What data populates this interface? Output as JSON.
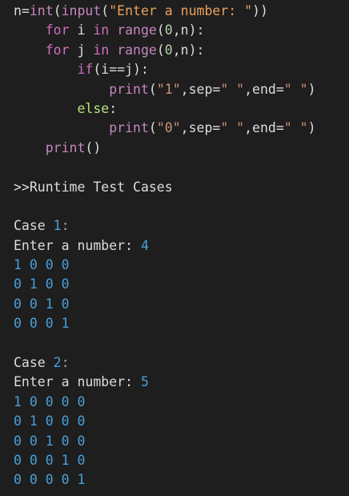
{
  "code": {
    "l1": {
      "a": "n=",
      "b": "int",
      "c": "(",
      "d": "input",
      "e": "(",
      "f": "\"Enter a number: \"",
      "g": "))"
    },
    "l2": {
      "indent": "    ",
      "kw": "for",
      "v": " i ",
      "kw2": "in",
      "sp": " ",
      "fn": "range",
      "p1": "(",
      "n0": "0",
      "rest": ",n):"
    },
    "l3": {
      "indent": "    ",
      "kw": "for",
      "v": " j ",
      "kw2": "in",
      "sp": " ",
      "fn": "range",
      "p1": "(",
      "n0": "0",
      "rest": ",n):"
    },
    "l4": {
      "indent": "        ",
      "kw": "if",
      "rest": "(i==j):"
    },
    "l5": {
      "indent": "            ",
      "fn": "print",
      "p1": "(",
      "s1": "\"1\"",
      "m1": ",sep=",
      "s2": "\" \"",
      "m2": ",end=",
      "s3": "\" \"",
      "p2": ")"
    },
    "l6": {
      "indent": "        ",
      "kw": "else",
      "rest": ":"
    },
    "l7": {
      "indent": "            ",
      "fn": "print",
      "p1": "(",
      "s1": "\"0\"",
      "m1": ",sep=",
      "s2": "\" \"",
      "m2": ",end=",
      "s3": "\" \"",
      "p2": ")"
    },
    "l8": {
      "indent": "    ",
      "fn": "print",
      "rest": "()"
    }
  },
  "runtime_header": ">>Runtime Test Cases",
  "case1": {
    "label": "Case ",
    "num": "1",
    "colon": ":",
    "prompt": "Enter a number: ",
    "input": "4",
    "rows": [
      "1 0 0 0",
      "0 1 0 0",
      "0 0 1 0",
      "0 0 0 1"
    ]
  },
  "case2": {
    "label": "Case ",
    "num": "2",
    "colon": ":",
    "prompt": "Enter a number: ",
    "input": "5",
    "rows": [
      "1 0 0 0 0",
      "0 1 0 0 0",
      "0 0 1 0 0",
      "0 0 0 1 0",
      "0 0 0 0 1"
    ]
  },
  "colors": {
    "background": "#1e1e1e",
    "keyword": "#d16fbf",
    "function": "#c586c0",
    "string": "#ce9178",
    "output_number": "#4a9fd8",
    "plain_text": "#dcdcdc"
  }
}
